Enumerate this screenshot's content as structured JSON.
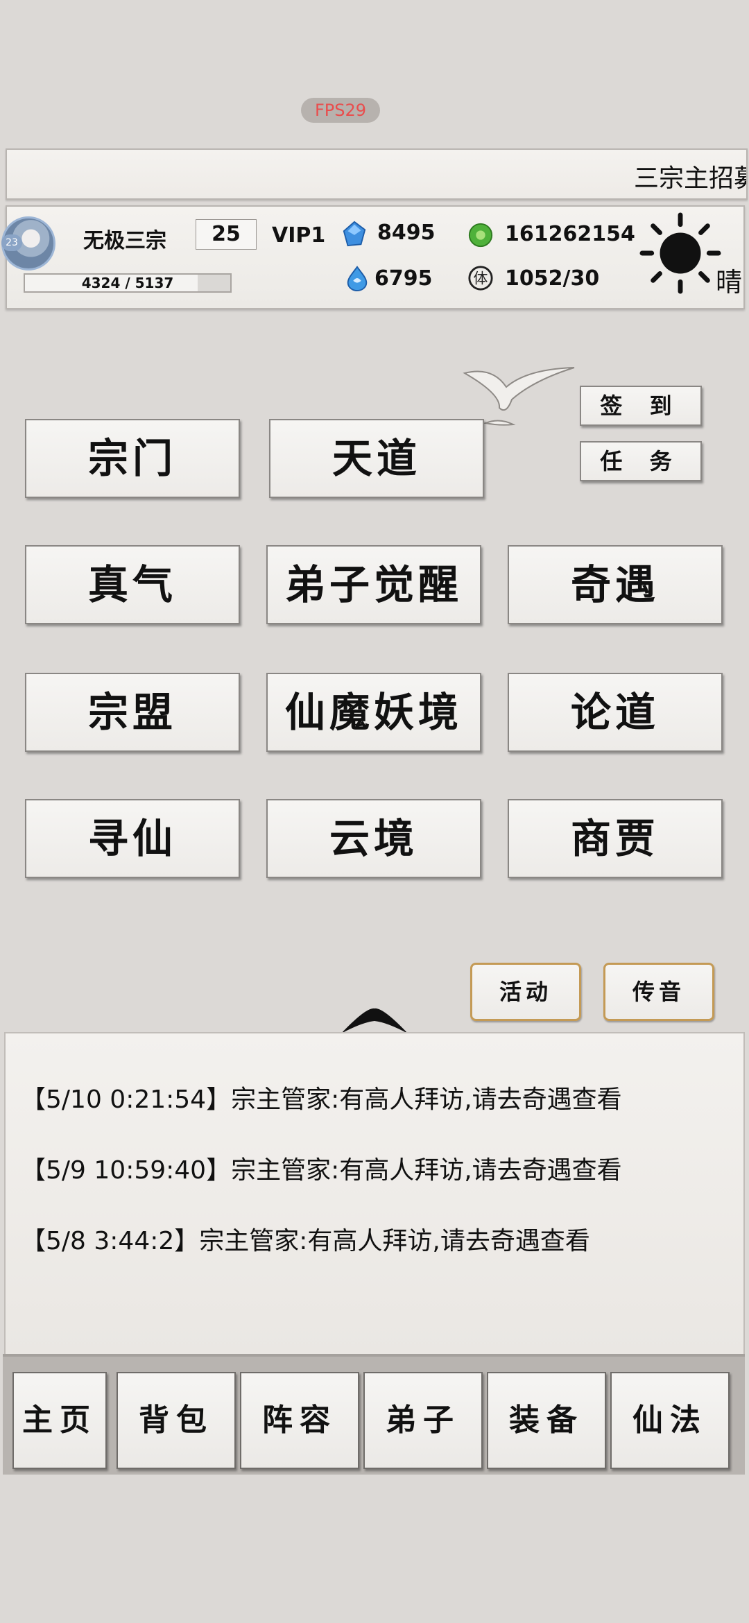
{
  "fps": "FPS29",
  "banner": {
    "text": "三宗主招募"
  },
  "player": {
    "sect_name": "无极三宗",
    "level": "25",
    "vip": "VIP1",
    "exp_text": "4324 / 5137",
    "exp_fraction": 0.842,
    "avatar_badge": "23"
  },
  "resources": {
    "crystal": "8495",
    "jade": "161262154",
    "spirit": "6795",
    "stamina": "1052/30"
  },
  "weather": {
    "icon": "sun-icon",
    "label": "晴"
  },
  "side_buttons": {
    "sign_in": "签 到",
    "task": "任 务"
  },
  "menu": {
    "zongmen": "宗门",
    "tiandao": "天道",
    "zhenqi": "真气",
    "dizi_juexing": "弟子觉醒",
    "qiyu": "奇遇",
    "zongmeng": "宗盟",
    "xianmo_yaojing": "仙魔妖境",
    "lundao": "论道",
    "xunxian": "寻仙",
    "yunjing": "云境",
    "shanggu": "商贾"
  },
  "event_buttons": {
    "activity": "活动",
    "broadcast": "传音"
  },
  "log": [
    "【5/10 0:21:54】宗主管家:有高人拜访,请去奇遇查看",
    "【5/9 10:59:40】宗主管家:有高人拜访,请去奇遇查看",
    "【5/8 3:44:2】宗主管家:有高人拜访,请去奇遇查看"
  ],
  "nav": [
    "主页",
    "背包",
    "阵容",
    "弟子",
    "装备",
    "仙法"
  ],
  "colors": {
    "background": "#dcd9d6",
    "gold_border": "#c49a55",
    "fps_text": "#e94d4d"
  }
}
